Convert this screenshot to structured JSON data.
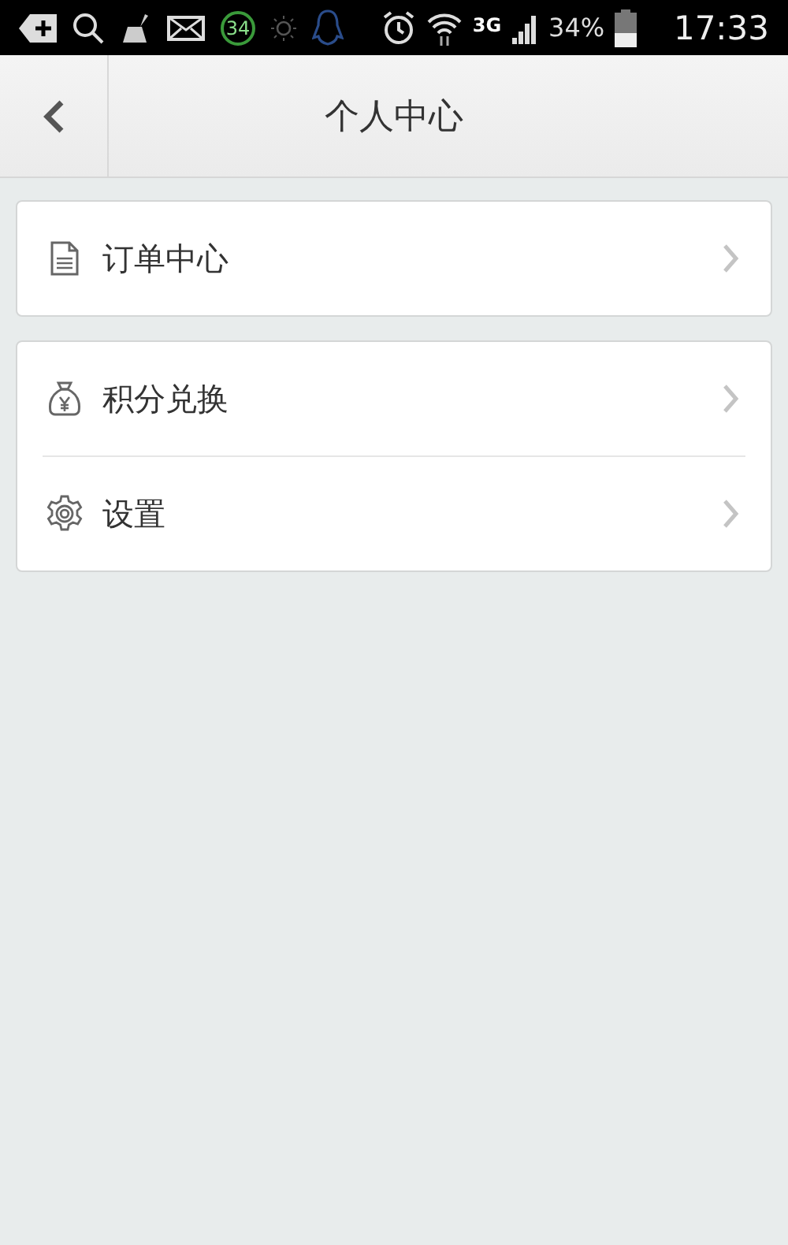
{
  "status_bar": {
    "badge": "34",
    "network": "3G",
    "battery": "34%",
    "time": "17:33"
  },
  "header": {
    "title": "个人中心"
  },
  "groups": [
    {
      "items": [
        {
          "label": "订单中心"
        }
      ]
    },
    {
      "items": [
        {
          "label": "积分兑换"
        },
        {
          "label": "设置"
        }
      ]
    }
  ]
}
